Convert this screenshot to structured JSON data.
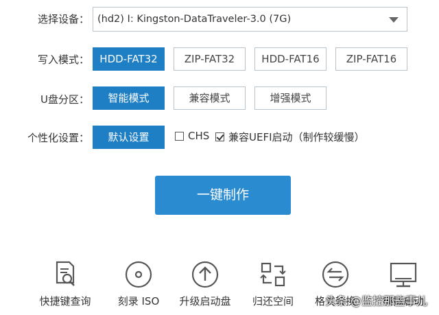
{
  "device": {
    "label": "选择设备：",
    "selected": "(hd2) I:  Kingston-DataTraveler-3.0 (7G)"
  },
  "write_mode": {
    "label": "写入模式：",
    "options": [
      "HDD-FAT32",
      "ZIP-FAT32",
      "HDD-FAT16",
      "ZIP-FAT16"
    ],
    "selected": "HDD-FAT32"
  },
  "partition": {
    "label": "U盘分区：",
    "options": [
      "智能模式",
      "兼容模式",
      "增强模式"
    ],
    "selected": "智能模式"
  },
  "personalize": {
    "label": "个性化设置：",
    "button": "默认设置",
    "chs_label": "CHS",
    "chs_checked": false,
    "uefi_label": "兼容UEFI启动（制作较缓慢）",
    "uefi_checked": true
  },
  "make_button": "一键制作",
  "tools": [
    {
      "label": "快捷键查询",
      "icon": "search-doc-icon"
    },
    {
      "label": "刻录 ISO",
      "icon": "disc-icon"
    },
    {
      "label": "升级启动盘",
      "icon": "upgrade-arrow-icon"
    },
    {
      "label": "归还空间",
      "icon": "restore-space-icon"
    },
    {
      "label": "格式转换",
      "icon": "convert-icon"
    },
    {
      "label": "模拟启动",
      "icon": "monitor-icon"
    }
  ],
  "watermark": "头条 @监控那些事儿",
  "colors": {
    "accent": "#1f7fc4",
    "button": "#2b8bd0",
    "icon": "#555555"
  }
}
